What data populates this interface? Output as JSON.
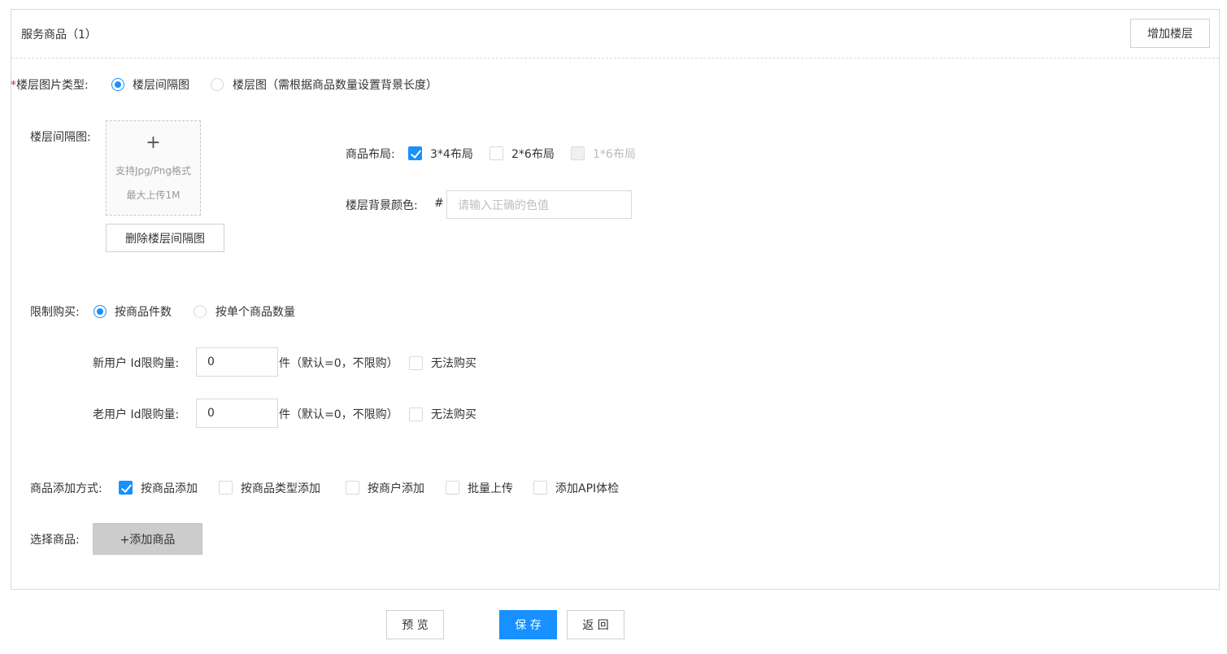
{
  "panel": {
    "title": "服务商品（1）",
    "add_floor_button": "增加楼层"
  },
  "floor_image_type": {
    "required_mark": "*",
    "label": "楼层图片类型:",
    "options": [
      "楼层间隔图",
      "楼层图（需根据商品数量设置背景长度）"
    ],
    "selected": "楼层间隔图"
  },
  "floor_interval_image": {
    "label": "楼层间隔图:",
    "upload_plus": "+",
    "hint_format": "支持Jpg/Png格式",
    "hint_size": "最大上传1M",
    "delete_button": "删除楼层间隔图"
  },
  "layout": {
    "label": "商品布局:",
    "options": [
      {
        "label": "3*4布局",
        "checked": true,
        "disabled": false
      },
      {
        "label": "2*6布局",
        "checked": false,
        "disabled": false
      },
      {
        "label": "1*6布局",
        "checked": false,
        "disabled": true
      }
    ]
  },
  "bg_color": {
    "label": "楼层背景颜色:",
    "prefix": "#",
    "placeholder": "请输入正确的色值",
    "value": ""
  },
  "purchase_limit": {
    "label": "限制购买:",
    "options": [
      "按商品件数",
      "按单个商品数量"
    ],
    "selected": "按商品件数",
    "new_user": {
      "label": "新用户 Id限购量:",
      "value": "0",
      "suffix": "件（默认=0，不限购）",
      "cannot_buy": "无法购买"
    },
    "old_user": {
      "label": "老用户 Id限购量:",
      "value": "0",
      "suffix": "件（默认=0，不限购）",
      "cannot_buy": "无法购买"
    }
  },
  "add_method": {
    "label": "商品添加方式:",
    "options": [
      {
        "label": "按商品添加",
        "checked": true
      },
      {
        "label": "按商品类型添加",
        "checked": false
      },
      {
        "label": "按商户添加",
        "checked": false
      },
      {
        "label": "批量上传",
        "checked": false
      },
      {
        "label": "添加API体检",
        "checked": false
      }
    ]
  },
  "select_goods": {
    "label": "选择商品:",
    "button": "+添加商品"
  },
  "footer": {
    "preview": "预 览",
    "save": "保 存",
    "back": "返 回"
  },
  "colors": {
    "primary": "#1890ff",
    "required": "#f5222d",
    "border": "#d9d9d9"
  }
}
